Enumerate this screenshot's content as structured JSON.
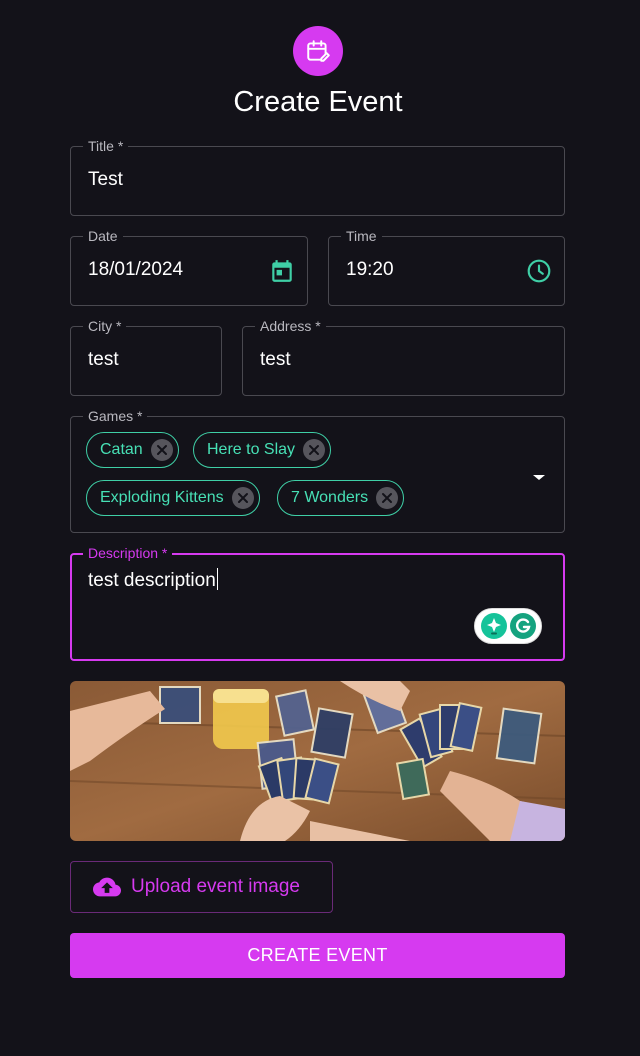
{
  "header": {
    "title": "Create Event",
    "logo_icon": "calendar-edit-icon",
    "logo_color": "#d63af0"
  },
  "form": {
    "title": {
      "label": "Title *",
      "value": "Test"
    },
    "date": {
      "label": "Date",
      "value": "18/01/2024",
      "icon": "calendar-icon"
    },
    "time": {
      "label": "Time",
      "value": "19:20",
      "icon": "clock-icon"
    },
    "city": {
      "label": "City *",
      "value": "test"
    },
    "address": {
      "label": "Address *",
      "value": "test"
    },
    "games": {
      "label": "Games *",
      "chips": [
        "Catan",
        "Here to Slay",
        "Exploding Kittens",
        "7 Wonders"
      ]
    },
    "description": {
      "label": "Description *",
      "value": "test description"
    }
  },
  "upload_button": {
    "label": "Upload event image",
    "icon": "cloud-upload-icon"
  },
  "create_button": {
    "label": "CREATE EVENT"
  },
  "colors": {
    "background": "#131219",
    "accent": "#d63af0",
    "chip": "#47e0b5",
    "icon_teal": "#3fcfa6",
    "border": "#4a4950"
  }
}
